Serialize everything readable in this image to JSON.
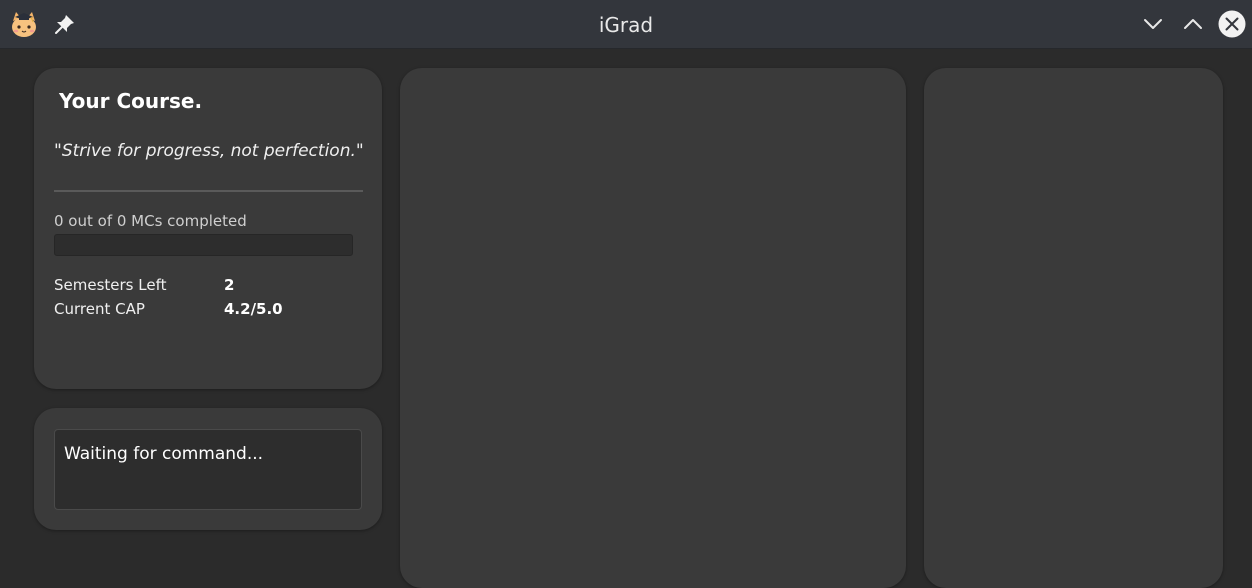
{
  "window": {
    "title": "iGrad",
    "app_icon": "cat-graduate-icon",
    "pin_icon": "pin-icon",
    "minimize_icon": "chevron-down-icon",
    "maximize_icon": "chevron-up-icon",
    "close_icon": "close-circle-icon"
  },
  "course": {
    "title": "Your Course.",
    "quote": "\"Strive for progress, not perfection.\"",
    "mcs_completed_text": "0 out of 0 MCs completed",
    "progress_fraction": 0,
    "stats": [
      {
        "label": "Semesters Left",
        "value": "2"
      },
      {
        "label": "Current CAP",
        "value": "4.2/5.0"
      }
    ]
  },
  "command": {
    "output_text": "Waiting for command..."
  },
  "colors": {
    "background": "#2b2b2b",
    "titlebar": "#33363c",
    "card": "#3a3a3a",
    "text": "#ffffff"
  }
}
